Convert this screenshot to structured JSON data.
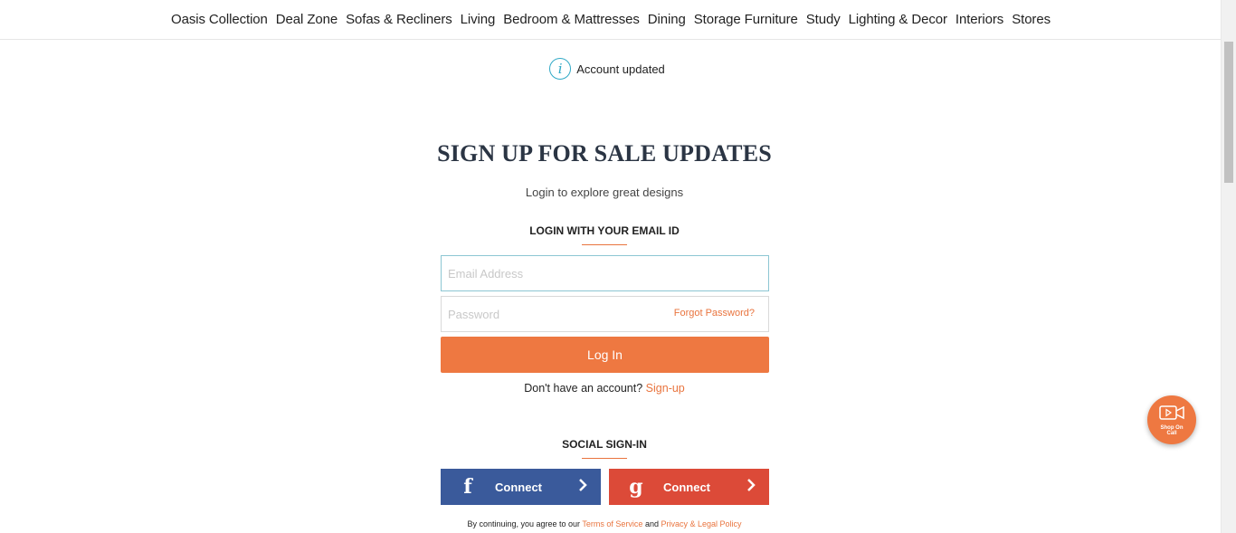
{
  "nav": {
    "items": [
      {
        "label": "Oasis Collection"
      },
      {
        "label": "Deal Zone"
      },
      {
        "label": "Sofas & Recliners"
      },
      {
        "label": "Living"
      },
      {
        "label": "Bedroom & Mattresses"
      },
      {
        "label": "Dining"
      },
      {
        "label": "Storage Furniture"
      },
      {
        "label": "Study"
      },
      {
        "label": "Lighting & Decor"
      },
      {
        "label": "Interiors"
      },
      {
        "label": "Stores"
      }
    ]
  },
  "notice": {
    "icon": "info-icon",
    "text": "Account updated"
  },
  "page": {
    "heading": "SIGN UP FOR SALE UPDATES",
    "subheading": "Login to explore great designs"
  },
  "login": {
    "section_title": "LOGIN WITH YOUR EMAIL ID",
    "email_placeholder": "Email Address",
    "email_value": "",
    "password_placeholder": "Password",
    "password_value": "",
    "forgot_label": "Forgot Password?",
    "button_label": "Log In",
    "no_account_text": "Don't have an account?",
    "signup_link": "Sign-up"
  },
  "social": {
    "section_title": "SOCIAL SIGN-IN",
    "facebook": {
      "icon": "f",
      "label": "Connect"
    },
    "google": {
      "icon": "g",
      "label": "Connect"
    }
  },
  "terms": {
    "prefix": "By continuing, you agree to our",
    "terms_link": "Terms of Service",
    "conjunction": "and",
    "privacy_link": "Privacy & Legal Policy"
  },
  "shop_on_call": {
    "icon": "video-camera-icon",
    "label": "Shop On Call"
  },
  "colors": {
    "accent": "#ee7841",
    "facebook": "#3a5a9b",
    "google": "#dc4a38",
    "heading": "#2b3544",
    "info": "#30a9c6"
  }
}
